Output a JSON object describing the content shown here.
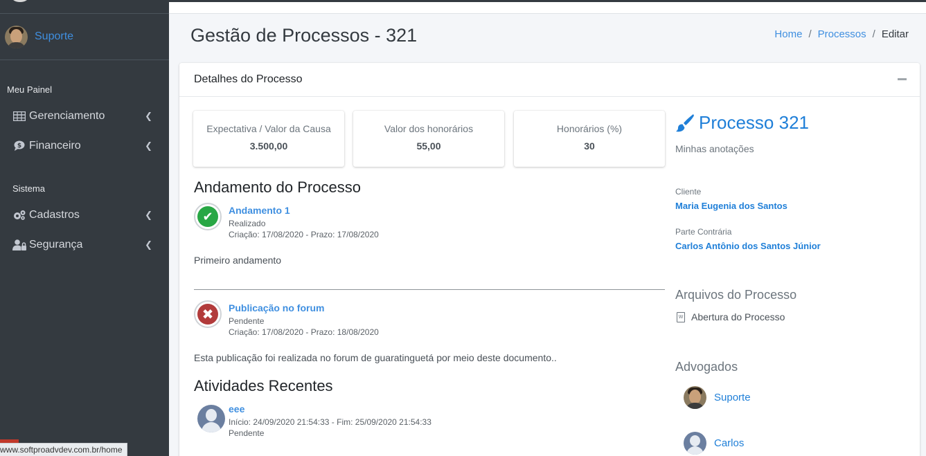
{
  "sidebar": {
    "user_name": "Suporte",
    "header_panel": "Meu Painel",
    "header_system": "Sistema",
    "items": [
      {
        "label": "Gerenciamento",
        "icon": "table-icon"
      },
      {
        "label": "Financeiro",
        "icon": "comment-dollar-icon"
      },
      {
        "label": "Cadastros",
        "icon": "cogs-icon"
      },
      {
        "label": "Segurança",
        "icon": "user-lock-icon"
      }
    ]
  },
  "status_bar": {
    "url": "www.softproadvdev.com.br/home"
  },
  "page": {
    "title": "Gestão de Processos - 321",
    "breadcrumb": {
      "home": "Home",
      "processos": "Processos",
      "current": "Editar",
      "separator": "/"
    }
  },
  "card": {
    "title": "Detalhes do Processo",
    "info_boxes": [
      {
        "title": "Expectativa / Valor da Causa",
        "value": "3.500,00"
      },
      {
        "title": "Valor dos honorários",
        "value": "55,00"
      },
      {
        "title": "Honorários (%)",
        "value": "30"
      }
    ],
    "andamento": {
      "heading": "Andamento do Processo",
      "items": [
        {
          "title": "Andamento 1",
          "status": "Realizado",
          "dates": "Criação: 17/08/2020 - Prazo: 17/08/2020",
          "body": "Primeiro andamento",
          "icon": "check-circle-icon"
        },
        {
          "title": "Publicação no forum",
          "status": "Pendente",
          "dates": "Criação: 17/08/2020 - Prazo: 18/08/2020",
          "body": "Esta publicação foi realizada no forum de guaratinguetá por meio deste documento..",
          "icon": "times-circle-icon"
        }
      ]
    },
    "atividades": {
      "heading": "Atividades Recentes",
      "items": [
        {
          "title": "eee",
          "dates": "Início: 24/09/2020 21:54:33 - Fim: 25/09/2020 21:54:33",
          "status": "Pendente"
        }
      ]
    },
    "right": {
      "process_title": "Processo 321",
      "notes": "Minhas anotações",
      "client_label": "Cliente",
      "client_name": "Maria Eugenia dos Santos",
      "opposing_label": "Parte Contrária",
      "opposing_name": "Carlos Antônio dos Santos Júnior",
      "files_heading": "Arquivos do Processo",
      "files": [
        {
          "name": "Abertura do Processo",
          "icon": "file-word-icon"
        }
      ],
      "lawyers_heading": "Advogados",
      "lawyers": [
        {
          "name": "Suporte"
        },
        {
          "name": "Carlos"
        }
      ]
    }
  },
  "colors": {
    "sidebar_bg": "#343a40",
    "link": "#1f7fd8",
    "success": "#28a745",
    "danger": "#b23b3b"
  }
}
